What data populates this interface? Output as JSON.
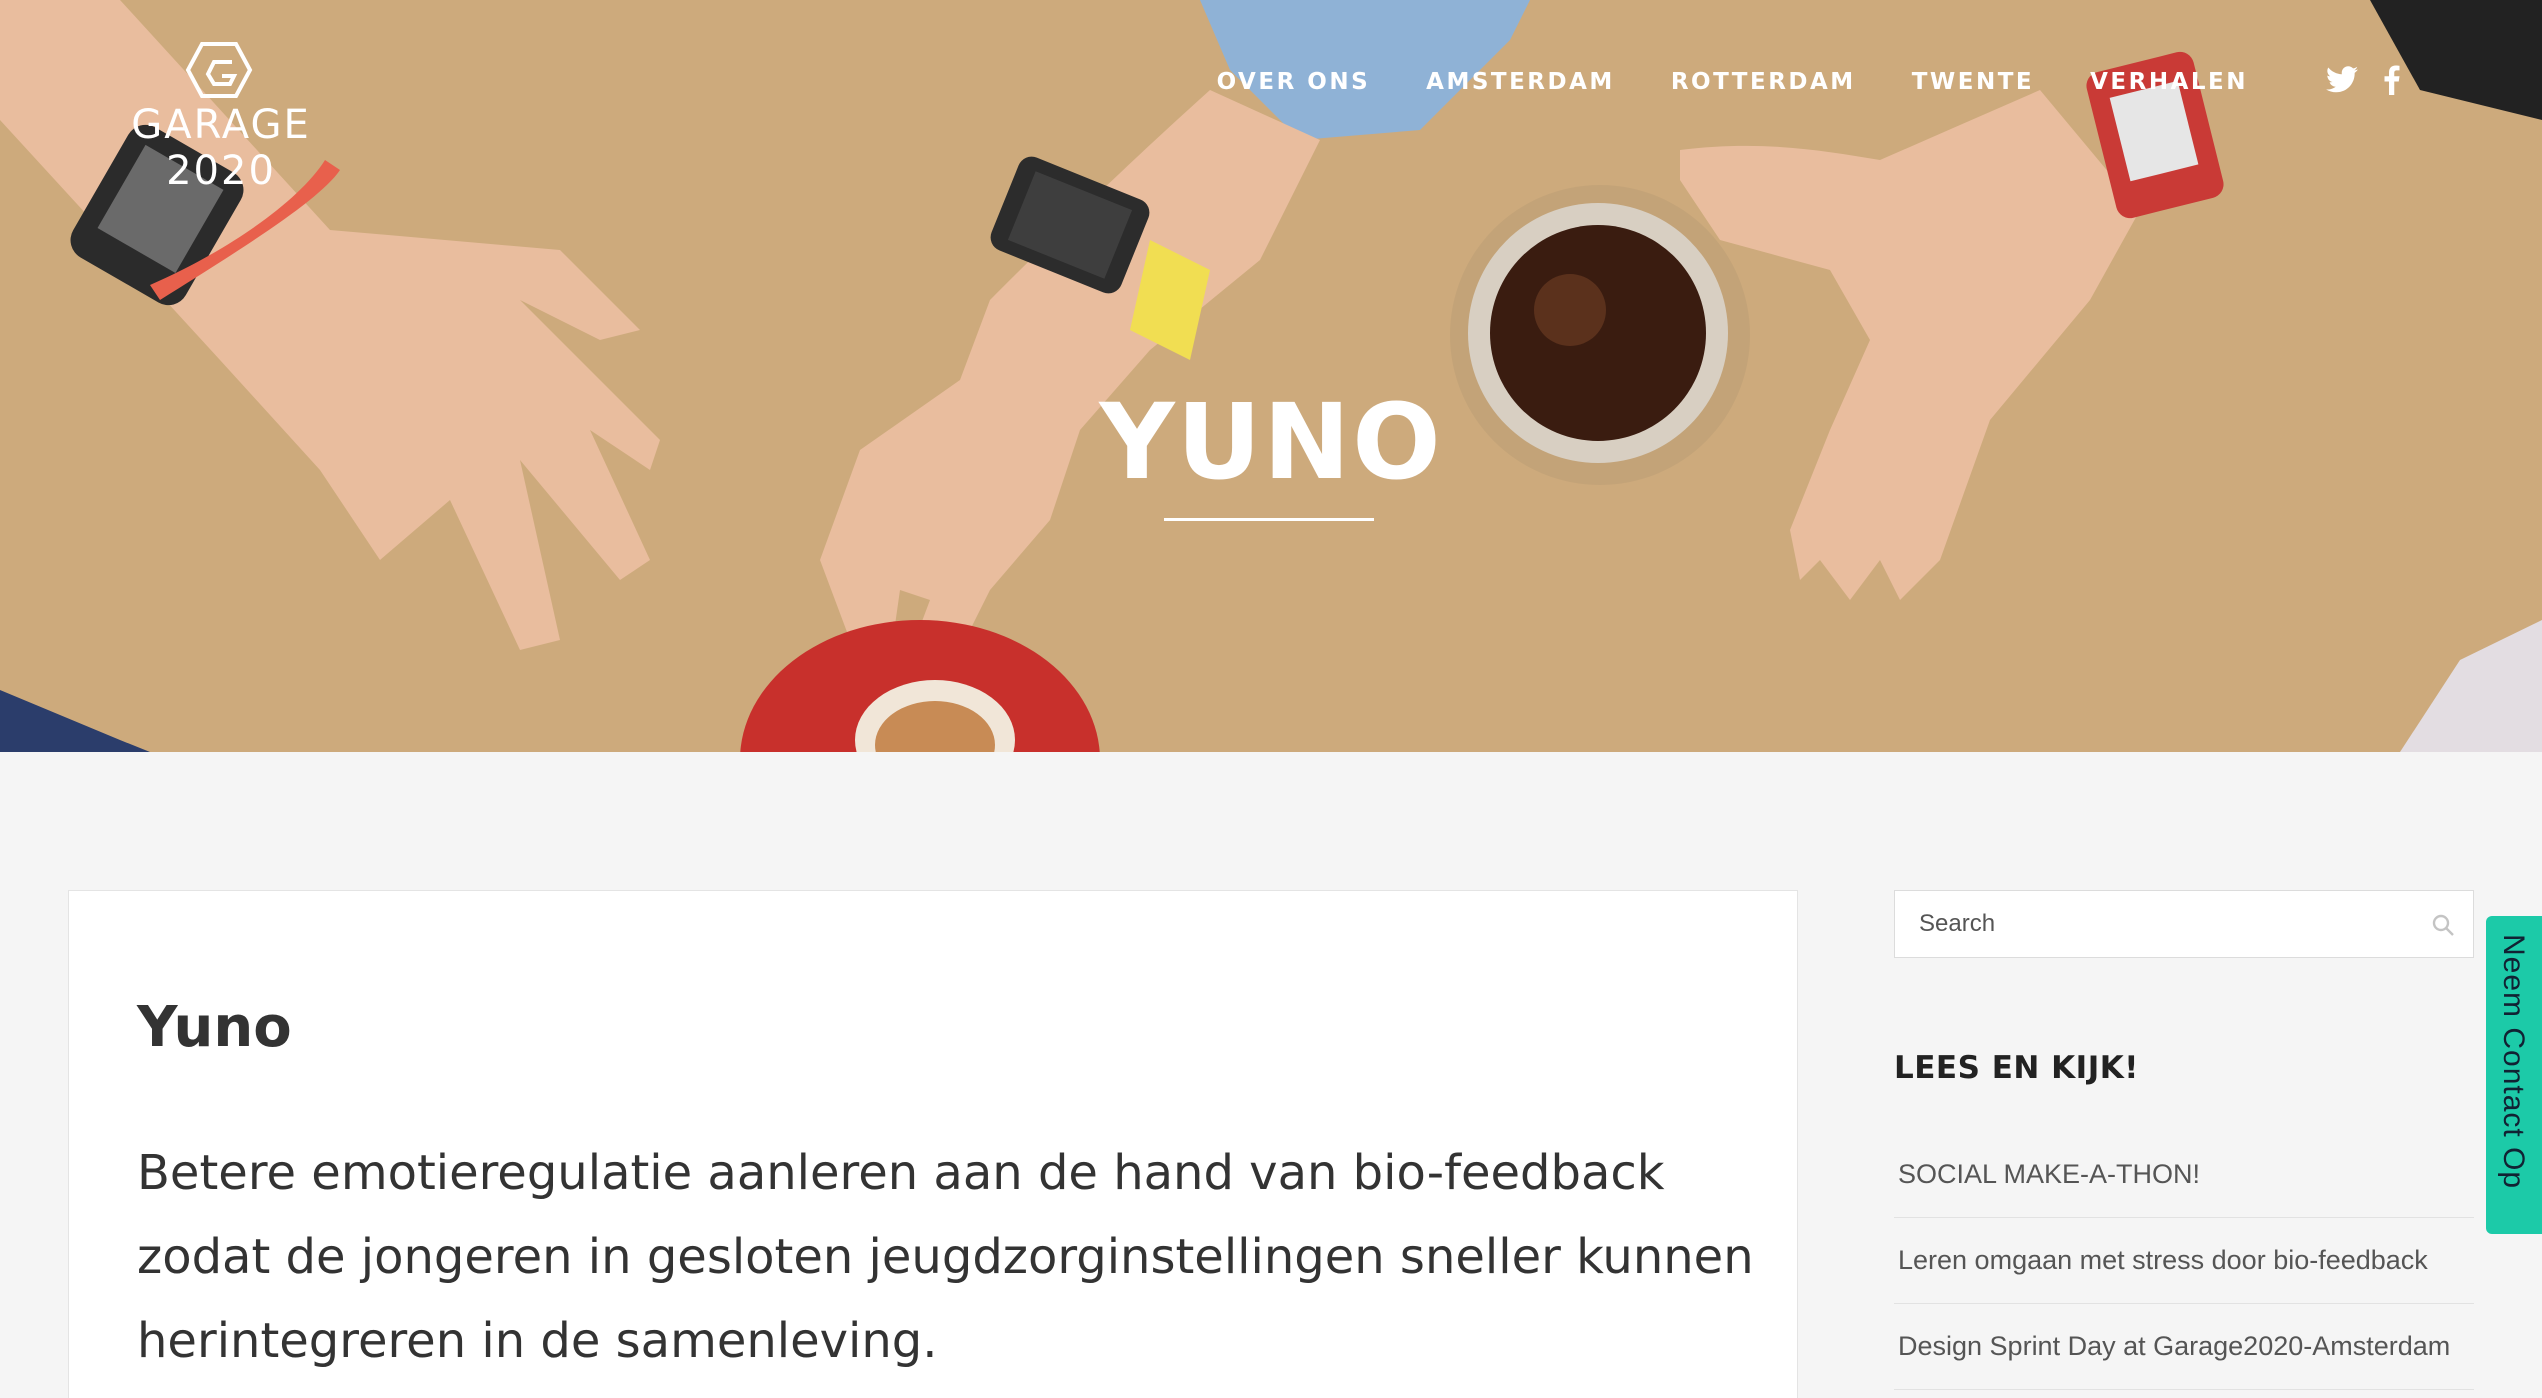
{
  "brand": {
    "line1": "GARAGE",
    "line2": "2020"
  },
  "nav": {
    "items": [
      "OVER ONS",
      "AMSTERDAM",
      "ROTTERDAM",
      "TWENTE",
      "VERHALEN"
    ]
  },
  "hero": {
    "title": "YUNO"
  },
  "post": {
    "title": "Yuno",
    "lead": "Betere emotieregulatie aanleren aan de hand van bio-feedback zodat de jongeren in gesloten jeugdzorginstellingen sneller kunnen herintegreren in de samenleving."
  },
  "sidebar": {
    "search_placeholder": "Search",
    "heading": "LEES EN KIJK!",
    "links": [
      "SOCIAL MAKE-A-THON!",
      "Leren omgaan met stress door bio-feedback",
      "Design Sprint Day at Garage2020-Amsterdam"
    ]
  },
  "contact_tab": {
    "label": "Neem Contact Op"
  },
  "colors": {
    "hero_bg": "#cdaa7c",
    "accent": "#1ccaa8"
  }
}
